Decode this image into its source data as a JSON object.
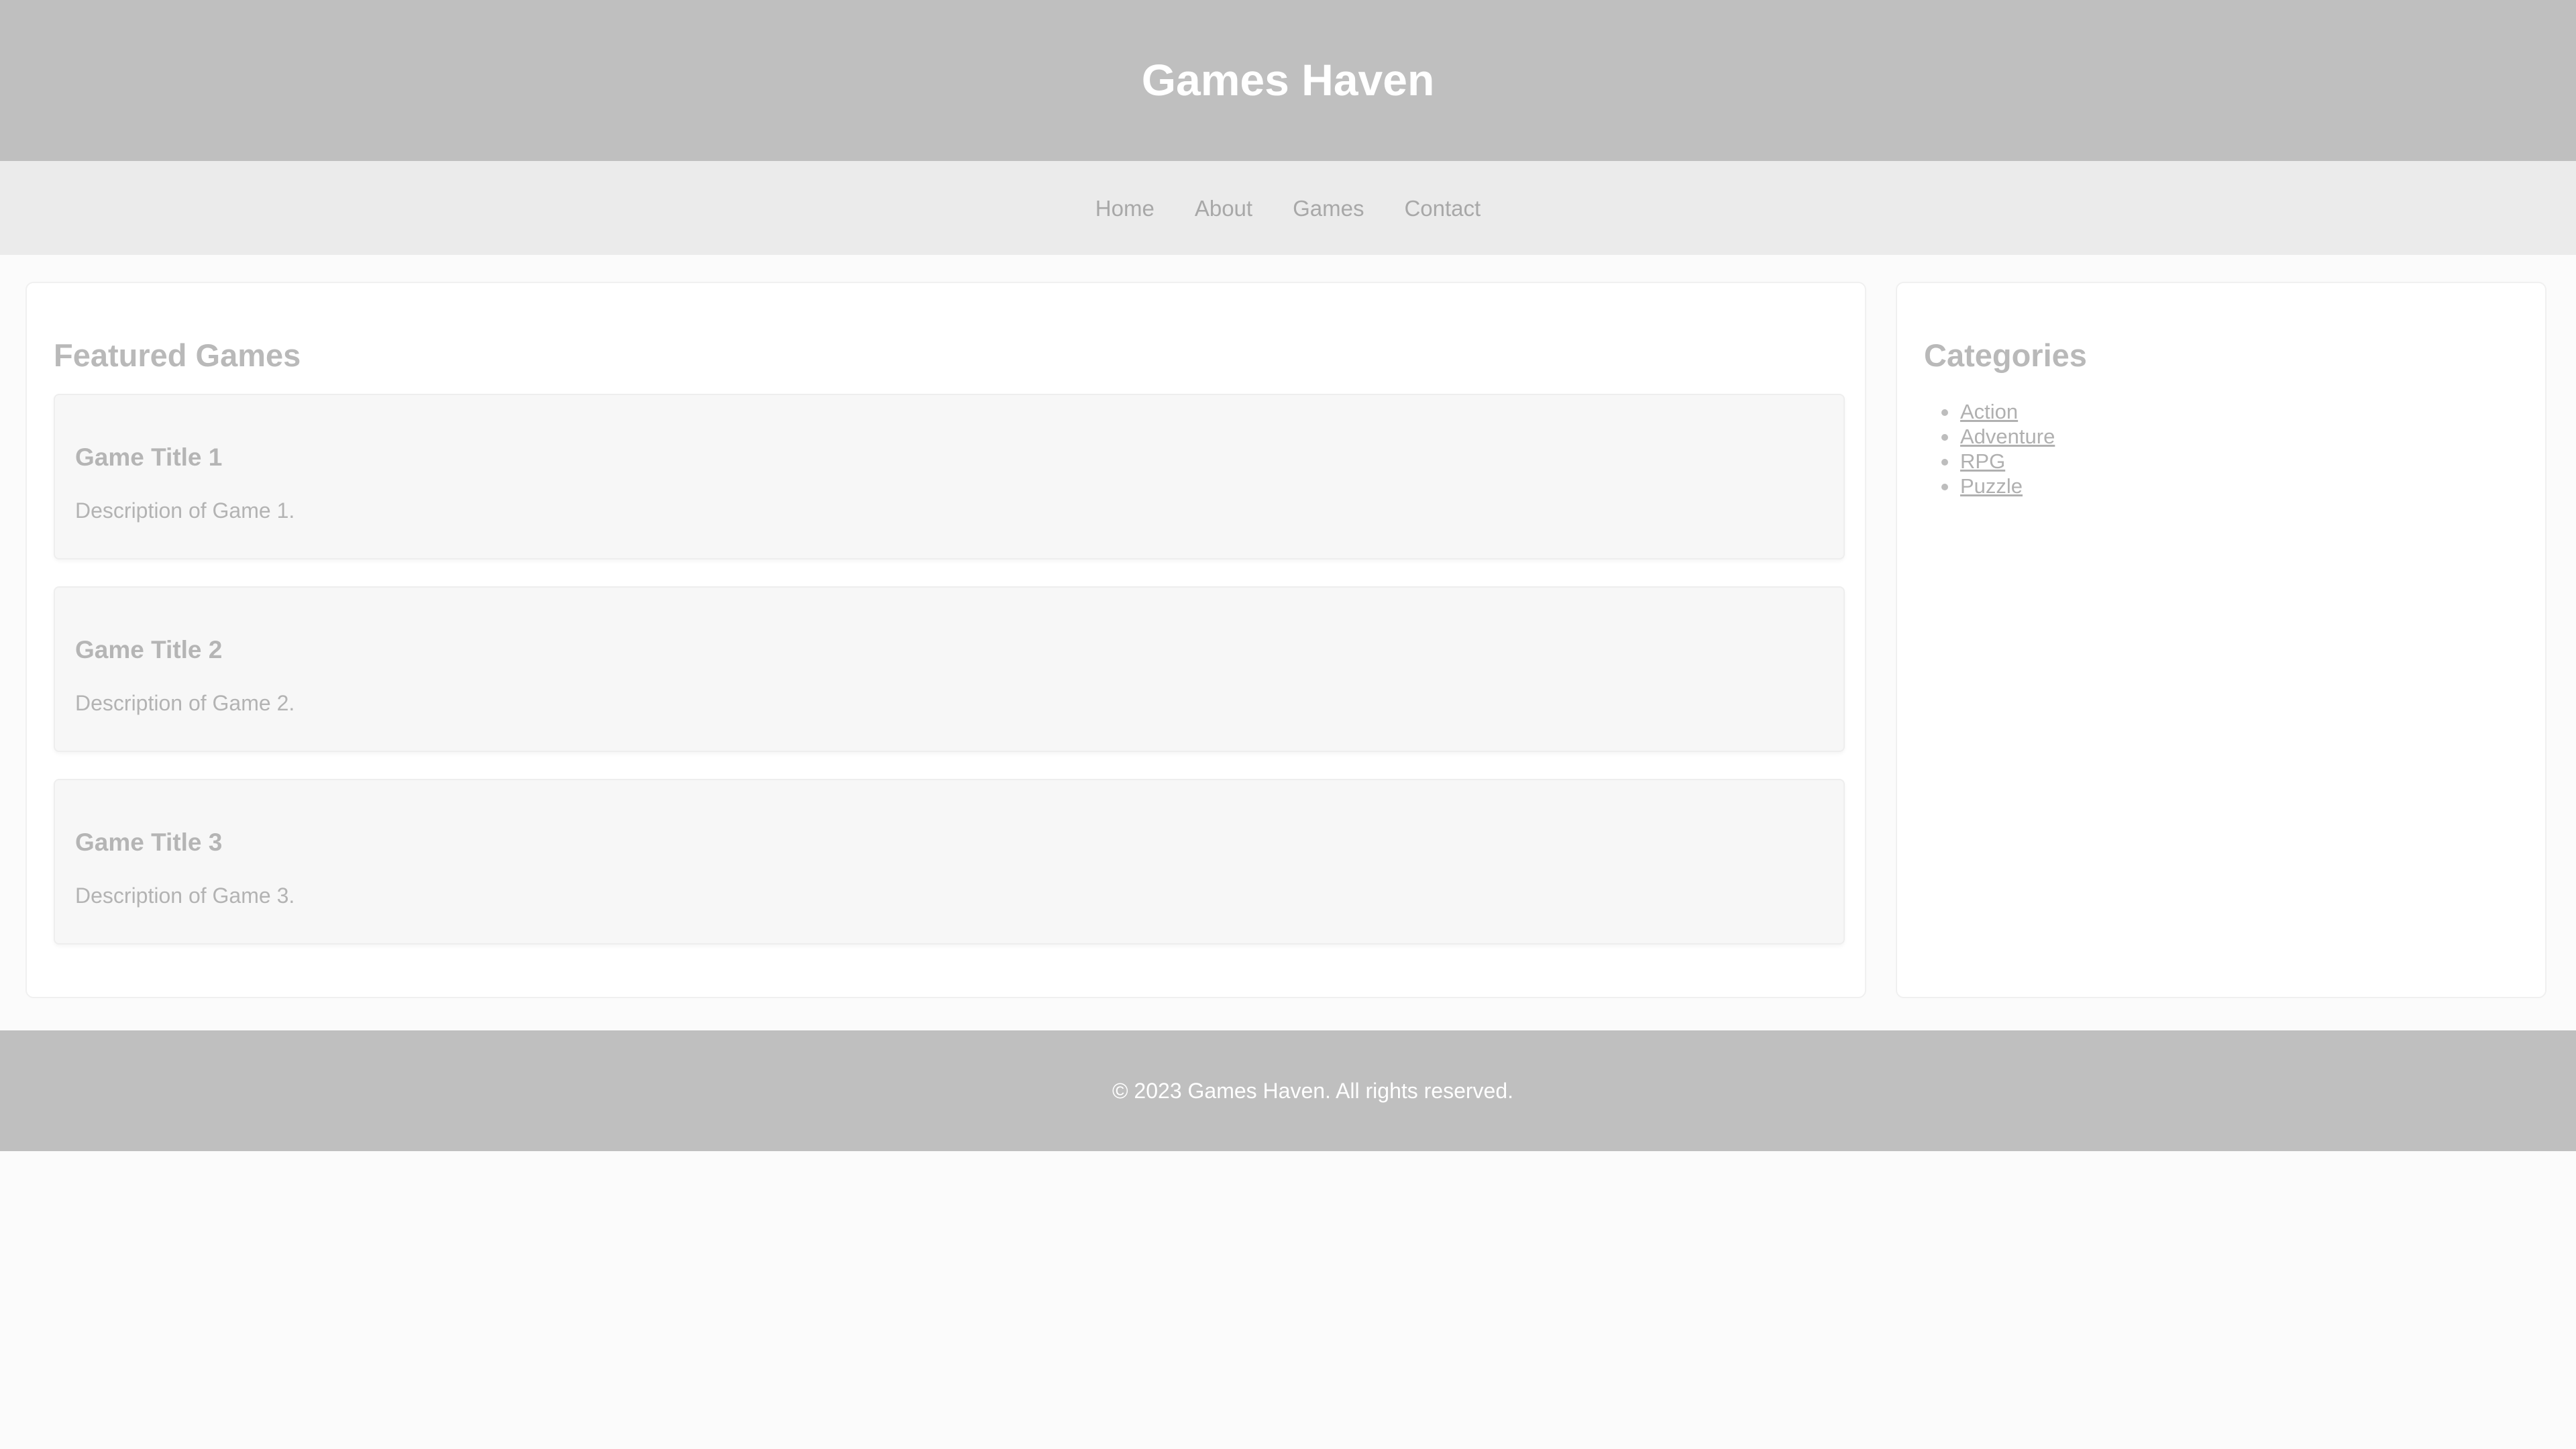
{
  "header": {
    "title": "Games Haven"
  },
  "nav": {
    "items": [
      {
        "label": "Home"
      },
      {
        "label": "About"
      },
      {
        "label": "Games"
      },
      {
        "label": "Contact"
      }
    ]
  },
  "main": {
    "title": "Featured Games",
    "games": [
      {
        "title": "Game Title 1",
        "description": "Description of Game 1."
      },
      {
        "title": "Game Title 2",
        "description": "Description of Game 2."
      },
      {
        "title": "Game Title 3",
        "description": "Description of Game 3."
      }
    ]
  },
  "sidebar": {
    "title": "Categories",
    "items": [
      {
        "label": "Action"
      },
      {
        "label": "Adventure"
      },
      {
        "label": "RPG"
      },
      {
        "label": "Puzzle"
      }
    ]
  },
  "footer": {
    "text": "© 2023 Games Haven. All rights reserved."
  },
  "colors": {
    "header_bg": "#bfbfbf",
    "nav_bg": "#ebebeb",
    "page_bg": "#fbfbfb",
    "card_bg": "#f7f7f7",
    "text_muted": "#b5b5b5"
  }
}
